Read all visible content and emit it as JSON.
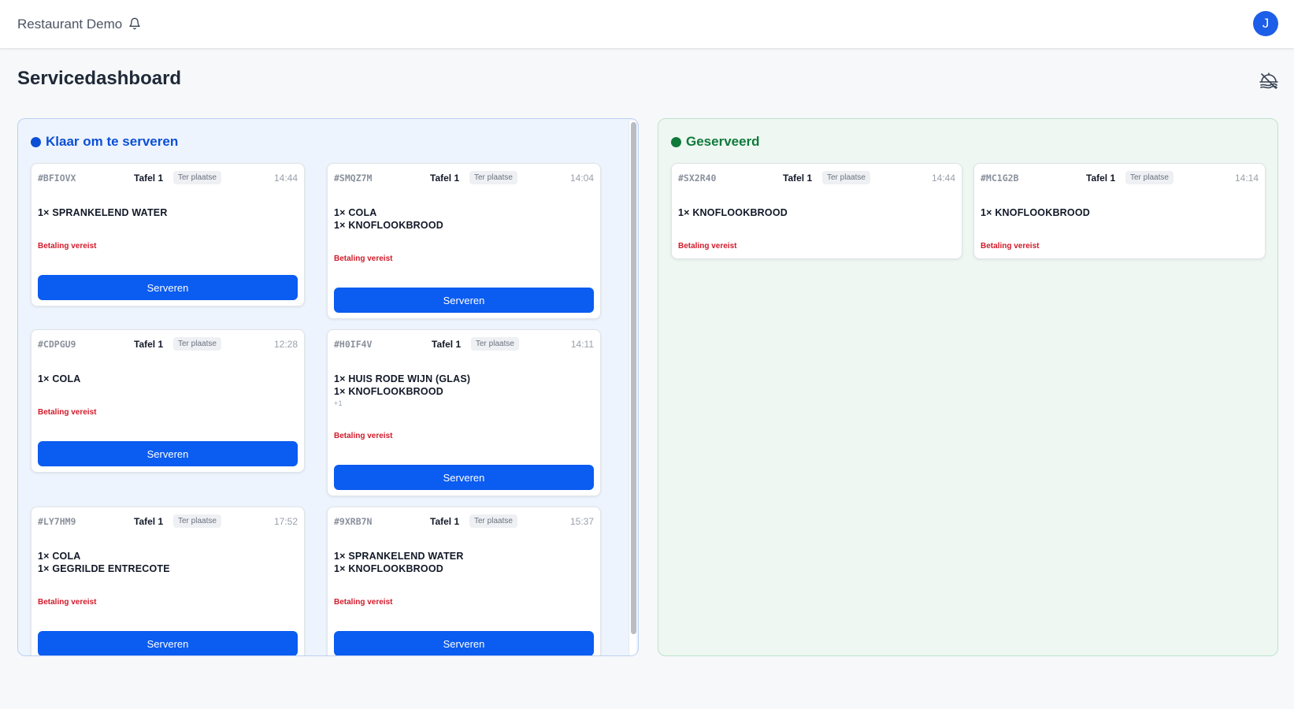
{
  "app": {
    "brand": "Restaurant Demo",
    "avatar_initial": "J"
  },
  "page": {
    "title": "Servicedashboard"
  },
  "colors": {
    "accent": "#0b5cf0",
    "served": "#0f7a3a",
    "payment": "#d11a2a"
  },
  "ready": {
    "title": "Klaar om te serveren",
    "orders": [
      {
        "id": "#BFIOVX",
        "table": "Tafel 1",
        "type": "Ter plaatse",
        "time": "14:44",
        "items": [
          "1× SPRANKELEND WATER"
        ],
        "payment": "Betaling vereist",
        "action": "Serveren"
      },
      {
        "id": "#SMQZ7M",
        "table": "Tafel 1",
        "type": "Ter plaatse",
        "time": "14:04",
        "items": [
          "1× COLA",
          "1× KNOFLOOKBROOD"
        ],
        "payment": "Betaling vereist",
        "action": "Serveren"
      },
      {
        "id": "#CDPGU9",
        "table": "Tafel 1",
        "type": "Ter plaatse",
        "time": "12:28",
        "items": [
          "1× COLA"
        ],
        "payment": "Betaling vereist",
        "action": "Serveren"
      },
      {
        "id": "#H0IF4V",
        "table": "Tafel 1",
        "type": "Ter plaatse",
        "time": "14:11",
        "items": [
          "1× HUIS RODE WIJN (GLAS)",
          "1× KNOFLOOKBROOD"
        ],
        "more": "+1",
        "payment": "Betaling vereist",
        "action": "Serveren"
      },
      {
        "id": "#LY7HM9",
        "table": "Tafel 1",
        "type": "Ter plaatse",
        "time": "17:52",
        "items": [
          "1× COLA",
          "1× GEGRILDE ENTRECOTE"
        ],
        "payment": "Betaling vereist",
        "action": "Serveren"
      },
      {
        "id": "#9XRB7N",
        "table": "Tafel 1",
        "type": "Ter plaatse",
        "time": "15:37",
        "items": [
          "1× SPRANKELEND WATER",
          "1× KNOFLOOKBROOD"
        ],
        "payment": "Betaling vereist",
        "action": "Serveren"
      }
    ]
  },
  "served": {
    "title": "Geserveerd",
    "orders": [
      {
        "id": "#SX2R40",
        "table": "Tafel 1",
        "type": "Ter plaatse",
        "time": "14:44",
        "items": [
          "1× KNOFLOOKBROOD"
        ],
        "payment": "Betaling vereist"
      },
      {
        "id": "#MC1G2B",
        "table": "Tafel 1",
        "type": "Ter plaatse",
        "time": "14:14",
        "items": [
          "1× KNOFLOOKBROOD"
        ],
        "payment": "Betaling vereist"
      }
    ]
  }
}
